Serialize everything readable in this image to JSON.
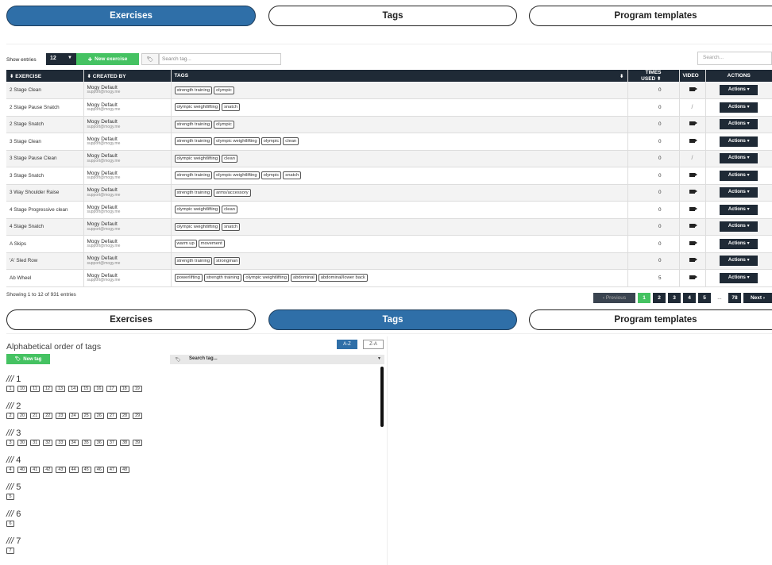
{
  "tabs_top": [
    {
      "label": "Exercises",
      "active": true
    },
    {
      "label": "Tags",
      "active": false
    },
    {
      "label": "Program templates",
      "active": false
    }
  ],
  "toolbar": {
    "show_entries_label": "Show entries",
    "entries_value": "12",
    "new_exercise_label": "New exercise",
    "search_tag_placeholder": "Search tag...",
    "search_placeholder": "Search..."
  },
  "table": {
    "headers": [
      "EXERCISE",
      "CREATED BY",
      "TAGS",
      "TIMES USED",
      "VIDEO",
      "ACTIONS"
    ],
    "rows": [
      {
        "exercise": "2 Stage Clean",
        "creator": "Mogy Default",
        "email": "support@mogy.me",
        "tags": [
          "strength training",
          "olympic"
        ],
        "times_used": "0",
        "video": true,
        "action": "Actions"
      },
      {
        "exercise": "2 Stage Pause Snatch",
        "creator": "Mogy Default",
        "email": "support@mogy.me",
        "tags": [
          "olympic weightlifting",
          "snatch"
        ],
        "times_used": "0",
        "video": false,
        "action": "Actions"
      },
      {
        "exercise": "2 Stage Snatch",
        "creator": "Mogy Default",
        "email": "support@mogy.me",
        "tags": [
          "strength training",
          "olympic"
        ],
        "times_used": "0",
        "video": true,
        "action": "Actions"
      },
      {
        "exercise": "3 Stage Clean",
        "creator": "Mogy Default",
        "email": "support@mogy.me",
        "tags": [
          "strength training",
          "olympic weightlifting",
          "olympic",
          "clean"
        ],
        "times_used": "0",
        "video": true,
        "action": "Actions"
      },
      {
        "exercise": "3 Stage Pause Clean",
        "creator": "Mogy Default",
        "email": "support@mogy.me",
        "tags": [
          "olympic weightlifting",
          "clean"
        ],
        "times_used": "0",
        "video": false,
        "action": "Actions"
      },
      {
        "exercise": "3 Stage Snatch",
        "creator": "Mogy Default",
        "email": "support@mogy.me",
        "tags": [
          "strength training",
          "olympic weightlifting",
          "olympic",
          "snatch"
        ],
        "times_used": "0",
        "video": true,
        "action": "Actions"
      },
      {
        "exercise": "3 Way Shoulder Raise",
        "creator": "Mogy Default",
        "email": "support@mogy.me",
        "tags": [
          "strength training",
          "arms/accessory"
        ],
        "times_used": "0",
        "video": true,
        "action": "Actions"
      },
      {
        "exercise": "4 Stage Progressive clean",
        "creator": "Mogy Default",
        "email": "support@mogy.me",
        "tags": [
          "olympic weightlifting",
          "clean"
        ],
        "times_used": "0",
        "video": true,
        "action": "Actions"
      },
      {
        "exercise": "4 Stage Snatch",
        "creator": "Mogy Default",
        "email": "support@mogy.me",
        "tags": [
          "olympic weightlifting",
          "snatch"
        ],
        "times_used": "0",
        "video": true,
        "action": "Actions"
      },
      {
        "exercise": "A Skips",
        "creator": "Mogy Default",
        "email": "support@mogy.me",
        "tags": [
          "warm up",
          "movement"
        ],
        "times_used": "0",
        "video": true,
        "action": "Actions"
      },
      {
        "exercise": "'A' Sled Row",
        "creator": "Mogy Default",
        "email": "support@mogy.me",
        "tags": [
          "strength training",
          "strongman"
        ],
        "times_used": "0",
        "video": true,
        "action": "Actions"
      },
      {
        "exercise": "Ab Wheel",
        "creator": "Mogy Default",
        "email": "support@mogy.me",
        "tags": [
          "powerlifting",
          "strength training",
          "olympic weightlifting",
          "abdominal",
          "abdominal/lower back"
        ],
        "times_used": "5",
        "video": true,
        "action": "Actions"
      }
    ]
  },
  "footer": {
    "showing_text": "Showing 1 to 12 of 931 entries",
    "pager": [
      "‹ Previous",
      "1",
      "2",
      "3",
      "4",
      "5",
      "...",
      "78",
      "Next ›"
    ]
  },
  "tabs_bottom": [
    {
      "label": "Exercises",
      "active": false
    },
    {
      "label": "Tags",
      "active": true
    },
    {
      "label": "Program templates",
      "active": false
    }
  ],
  "tags_panel": {
    "title": "Alphabetical order of tags",
    "sort_az": "A-Z",
    "sort_za": "Z-A",
    "new_tag_label": "New tag",
    "search_tag_value": "Search tag...",
    "groups": [
      {
        "heading": "1",
        "tags": [
          "1",
          "10",
          "11",
          "12",
          "13",
          "14",
          "15",
          "16",
          "17",
          "18",
          "19"
        ]
      },
      {
        "heading": "2",
        "tags": [
          "2",
          "20",
          "21",
          "22",
          "23",
          "24",
          "25",
          "26",
          "27",
          "28",
          "29"
        ]
      },
      {
        "heading": "3",
        "tags": [
          "3",
          "30",
          "31",
          "32",
          "33",
          "34",
          "35",
          "36",
          "37",
          "38",
          "39"
        ]
      },
      {
        "heading": "4",
        "tags": [
          "4",
          "40",
          "41",
          "42",
          "43",
          "44",
          "45",
          "46",
          "47",
          "48"
        ]
      },
      {
        "heading": "5",
        "tags": [
          "5"
        ]
      },
      {
        "heading": "6",
        "tags": [
          "6"
        ]
      },
      {
        "heading": "7",
        "tags": [
          "7"
        ]
      }
    ]
  }
}
